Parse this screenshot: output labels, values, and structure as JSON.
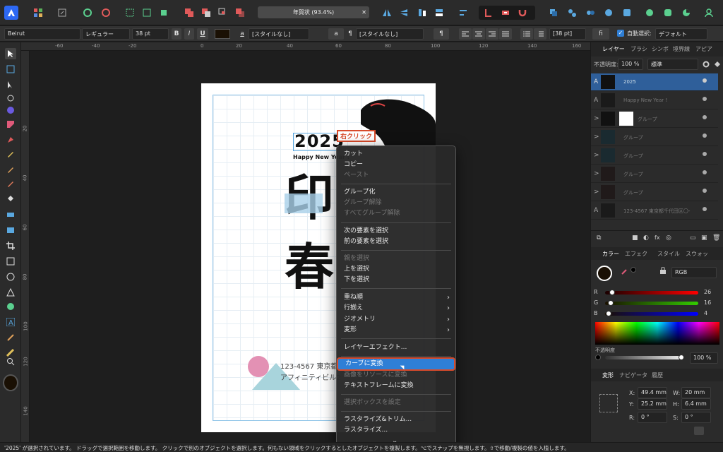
{
  "toolbar": {
    "doc_title": "年賀状 (93.4%)",
    "accent": "#2f7fd6",
    "brand_color": "#2d68f3",
    "buttons": [
      "app-menu-icon",
      "persona-pixel-icon",
      "persona-export-icon",
      "settings-icon",
      "snapping-icon",
      "select-all-icon",
      "bounding-icon",
      "align-icon",
      "boolean-add-icon",
      "boolean-subtract-icon",
      "boolean-intersect-icon",
      "boolean-xor-icon",
      "flip-horizontal-icon",
      "flip-vertical-icon",
      "arrange-icon",
      "snap-icon",
      "insert-icon",
      "magnet-icon",
      "layers-icon",
      "zoom-icon",
      "view-icon",
      "view-mode-icon",
      "assistant-icon",
      "pen-icon",
      "color-icon",
      "user-icon"
    ]
  },
  "context_toolbar": {
    "font": "Beirut",
    "weight": "レギュラー",
    "size": "38 pt",
    "bold": "B",
    "italic": "I",
    "underline": "U",
    "char_style_icon": "a",
    "char_style": "[スタイルなし]",
    "para_icon": "a",
    "para_style_icon": "¶",
    "para_style": "[スタイルなし]",
    "pilcrow": "¶",
    "leading": "[38 pt]",
    "ligature": "fi",
    "auto_select_label": "自動選択:",
    "auto_select_value": "デフォルト"
  },
  "rulers": {
    "top_labels": [
      "-60",
      "-40",
      "-20",
      "0",
      "20",
      "40",
      "60",
      "80",
      "100",
      "120",
      "140",
      "160"
    ],
    "left_labels": [
      "20",
      "40",
      "60",
      "80",
      "100",
      "120",
      "140"
    ]
  },
  "page": {
    "year_text": "2025",
    "sub_text": "Happy New Year !",
    "big_char_1": "印",
    "big_char_2": "春",
    "address_1": "123-4567 東京都",
    "address_2": "アフィニティビル2",
    "callout_label": "右クリック"
  },
  "context_menu": {
    "items": [
      {
        "label": "カット",
        "enabled": true
      },
      {
        "label": "コピー",
        "enabled": true
      },
      {
        "label": "ペースト",
        "enabled": false
      },
      {
        "label": "グループ化",
        "enabled": true
      },
      {
        "label": "グループ解除",
        "enabled": false
      },
      {
        "label": "すべてグループ解除",
        "enabled": false
      },
      {
        "label": "次の要素を選択",
        "enabled": true
      },
      {
        "label": "前の要素を選択",
        "enabled": true
      },
      {
        "label": "親を選択",
        "enabled": false
      },
      {
        "label": "上を選択",
        "enabled": true
      },
      {
        "label": "下を選択",
        "enabled": true
      },
      {
        "label": "重ね順",
        "enabled": true,
        "submenu": true
      },
      {
        "label": "行揃え",
        "enabled": true,
        "submenu": true
      },
      {
        "label": "ジオメトリ",
        "enabled": true,
        "submenu": true
      },
      {
        "label": "変形",
        "enabled": true,
        "submenu": true
      },
      {
        "label": "レイヤーエフェクト...",
        "enabled": true
      },
      {
        "label": "カーブに変換",
        "enabled": true,
        "highlighted": true
      },
      {
        "label": "画像をリソースに変換",
        "enabled": false
      },
      {
        "label": "テキストフレームに変換",
        "enabled": true
      },
      {
        "label": "選択ボックスを設定",
        "enabled": false
      },
      {
        "label": "ラスタライズ&トリム...",
        "enabled": true
      },
      {
        "label": "ラスタライズ...",
        "enabled": true
      }
    ],
    "more_icon": "⌄"
  },
  "layers_panel": {
    "tabs": [
      "レイヤー",
      "ブラシ",
      "シンボ",
      "境界線",
      "アピア"
    ],
    "opacity_label": "不透明度:",
    "opacity_value": "100 %",
    "blend_mode": "標準",
    "layers": [
      {
        "name": "2025",
        "type": "A",
        "selected": true
      },
      {
        "name": "Happy New Year !",
        "type": "A"
      },
      {
        "name": "グループ",
        "type": ">"
      },
      {
        "name": "グループ",
        "type": ">"
      },
      {
        "name": "グループ",
        "type": ">"
      },
      {
        "name": "グループ",
        "type": ">"
      },
      {
        "name": "グループ",
        "type": ">"
      },
      {
        "name": "123-4567 東京都千代田区〇-",
        "type": "A"
      }
    ]
  },
  "color_panel": {
    "tabs": [
      "カラー",
      "エフェク",
      "スタイル",
      "スウォッ"
    ],
    "model": "RGB",
    "r_label": "R",
    "r": "26",
    "g_label": "G",
    "g": "16",
    "b_label": "B",
    "b": "4",
    "opacity_label": "不透明度",
    "opacity_value": "100 %",
    "fill_color": "#1a1004"
  },
  "transform_panel": {
    "tabs": [
      "変形",
      "ナビゲータ",
      "履歴"
    ],
    "x_label": "X:",
    "x": "49.4 mm",
    "y_label": "Y:",
    "y": "25.2 mm",
    "w_label": "W:",
    "w": "20 mm",
    "h_label": "H:",
    "h": "6.4 mm",
    "r_label": "R:",
    "r": "0 °",
    "s_label": "S:",
    "s": "0 °"
  },
  "status_bar": {
    "text": "'2025' が選択されています。 ドラッグで選択範囲を移動します。 クリックで別のオブジェクトを選択します。何もない領域をクリックするとしたオブジェクトを複製します。⌥でスナップを無視します。⇧で移動/複製の値を入植します。"
  }
}
